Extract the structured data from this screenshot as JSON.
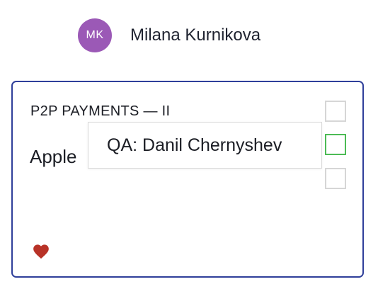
{
  "user": {
    "initials": "MK",
    "name": "Milana Kurnikova",
    "avatar_color": "#9b59b6"
  },
  "card": {
    "title": "P2P PAYMENTS — II",
    "body_text": "Apple",
    "border_color": "#2f3f9a",
    "checkboxes": [
      {
        "state": "unchecked"
      },
      {
        "state": "highlighted",
        "color": "#4cbb55"
      },
      {
        "state": "unchecked"
      }
    ],
    "icon": "heart-icon",
    "icon_color": "#b83227"
  },
  "tooltip": {
    "text": "QA: Danil Chernyshev"
  }
}
